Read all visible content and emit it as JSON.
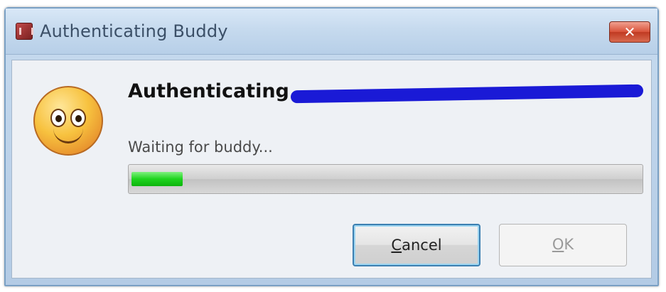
{
  "window": {
    "title": "Authenticating Buddy",
    "close_label": "✕"
  },
  "dialog": {
    "heading": "Authenticating",
    "status": "Waiting for buddy...",
    "progress_fraction": 0.1
  },
  "buttons": {
    "cancel_prefix": "",
    "cancel_mnemonic": "C",
    "cancel_rest": "ancel",
    "ok_mnemonic": "O",
    "ok_rest": "K",
    "ok_enabled": false
  },
  "colors": {
    "redaction": "#1a1ad6",
    "progress_fill": "#1ed41e"
  },
  "icons": {
    "title_icon": "app-icon",
    "dialog_icon": "smiley-face-icon"
  }
}
